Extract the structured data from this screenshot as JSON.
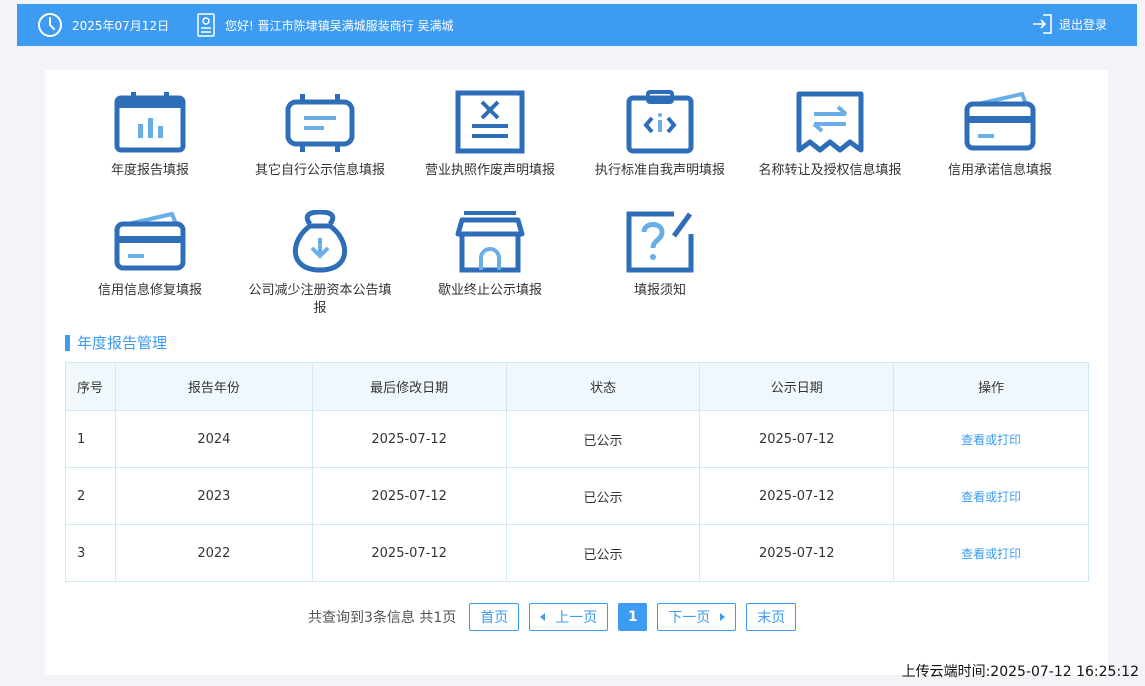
{
  "header": {
    "date": "2025年07月12日",
    "greeting": "您好!  晋江市陈埭镇吴满城服装商行  吴满城",
    "logout_label": "退出登录",
    "clock_icon": "clock-icon",
    "user_icon": "id-card-icon",
    "logout_icon": "logout-icon"
  },
  "tiles": [
    {
      "label": "年度报告填报",
      "icon": "calendar-chart-icon"
    },
    {
      "label": "其它自行公示信息填报",
      "icon": "message-board-icon"
    },
    {
      "label": "营业执照作废声明填报",
      "icon": "cancel-document-icon"
    },
    {
      "label": "执行标准自我声明填报",
      "icon": "clipboard-code-icon"
    },
    {
      "label": "名称转让及授权信息填报",
      "icon": "transfer-receipt-icon"
    },
    {
      "label": "信用承诺信息填报",
      "icon": "card-icon"
    },
    {
      "label": "信用信息修复填报",
      "icon": "card-repair-icon"
    },
    {
      "label": "公司减少注册资本公告填报",
      "icon": "money-bag-icon"
    },
    {
      "label": "歇业终止公示填报",
      "icon": "store-icon"
    },
    {
      "label": "填报须知",
      "icon": "question-board-icon"
    }
  ],
  "section": {
    "title": "年度报告管理"
  },
  "table": {
    "columns": [
      "序号",
      "报告年份",
      "最后修改日期",
      "状态",
      "公示日期",
      "操作"
    ],
    "rows": [
      {
        "idx": "1",
        "year": "2024",
        "modified": "2025-07-12",
        "status": "已公示",
        "published": "2025-07-12",
        "action": "查看或打印"
      },
      {
        "idx": "2",
        "year": "2023",
        "modified": "2025-07-12",
        "status": "已公示",
        "published": "2025-07-12",
        "action": "查看或打印"
      },
      {
        "idx": "3",
        "year": "2022",
        "modified": "2025-07-12",
        "status": "已公示",
        "published": "2025-07-12",
        "action": "查看或打印"
      }
    ]
  },
  "pager": {
    "info": "共查询到3条信息 共1页",
    "first": "首页",
    "prev": "上一页",
    "current": "1",
    "next": "下一页",
    "last": "末页"
  },
  "upload_time": "上传云端时间:2025-07-12 16:25:12",
  "colors": {
    "accent": "#3d9bf2",
    "icon": "#2e6db7",
    "table_border": "#cfe8f4"
  }
}
